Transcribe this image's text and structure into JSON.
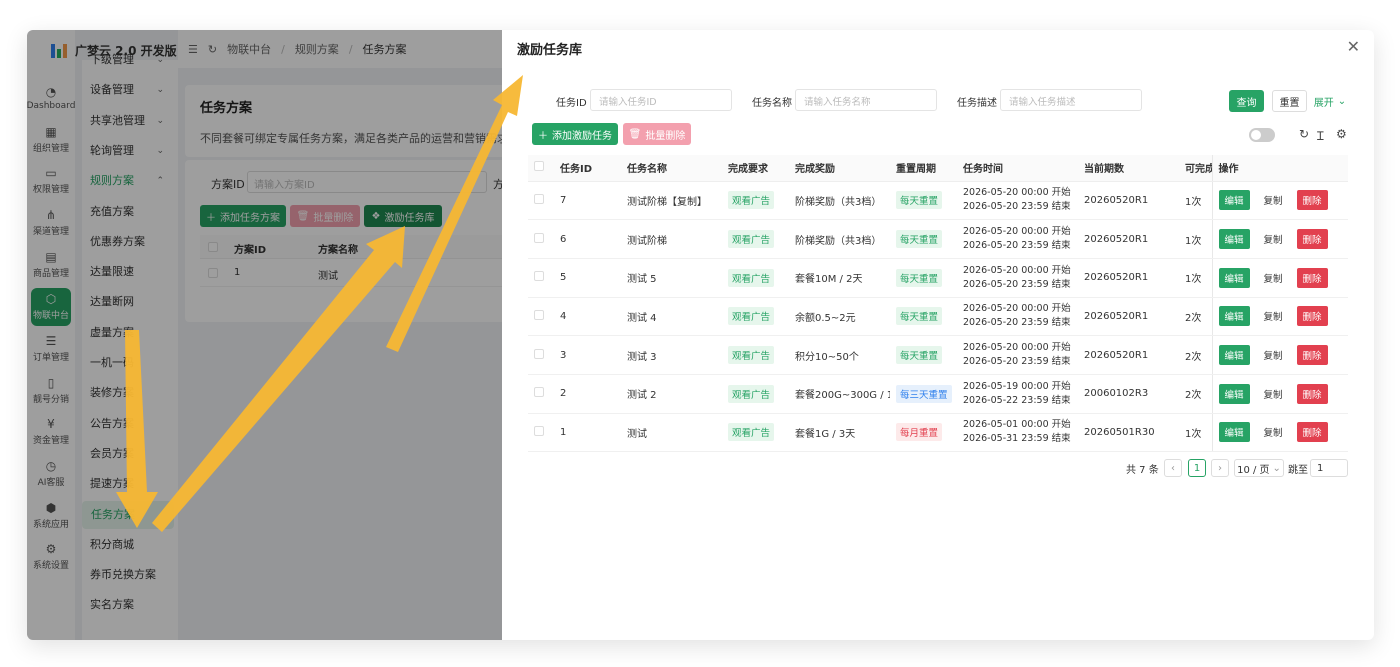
{
  "app": {
    "logo_text": "广梦云 2.0 开发版"
  },
  "rail": [
    {
      "icon": "dashboard-icon",
      "glyph": "◔",
      "label": "Dashboard"
    },
    {
      "icon": "org-icon",
      "glyph": "▦",
      "label": "组织管理"
    },
    {
      "icon": "monitor-icon",
      "glyph": "▭",
      "label": "权限管理"
    },
    {
      "icon": "channel-icon",
      "glyph": "⋔",
      "label": "渠道管理"
    },
    {
      "icon": "store-icon",
      "glyph": "▤",
      "label": "商品管理"
    },
    {
      "icon": "iot-icon",
      "glyph": "⬡",
      "label": "物联中台"
    },
    {
      "icon": "order-icon",
      "glyph": "☰",
      "label": "订单管理"
    },
    {
      "icon": "phone-icon",
      "glyph": "▯",
      "label": "靓号分销"
    },
    {
      "icon": "fund-icon",
      "glyph": "¥",
      "label": "资金管理"
    },
    {
      "icon": "ai-icon",
      "glyph": "◷",
      "label": "AI客服"
    },
    {
      "icon": "apps-icon",
      "glyph": "⬢",
      "label": "系统应用"
    },
    {
      "icon": "settings-icon",
      "glyph": "⚙",
      "label": "系统设置"
    }
  ],
  "menu2": [
    {
      "label": "下级管理",
      "type": "group"
    },
    {
      "label": "设备管理",
      "type": "group"
    },
    {
      "label": "共享池管理",
      "type": "group"
    },
    {
      "label": "轮询管理",
      "type": "group"
    },
    {
      "label": "规则方案",
      "type": "open"
    },
    {
      "label": "充值方案",
      "type": "sub"
    },
    {
      "label": "优惠券方案",
      "type": "sub"
    },
    {
      "label": "达量限速",
      "type": "sub"
    },
    {
      "label": "达量断网",
      "type": "sub"
    },
    {
      "label": "虚量方案",
      "type": "sub"
    },
    {
      "label": "一机一码",
      "type": "sub"
    },
    {
      "label": "装修方案",
      "type": "sub"
    },
    {
      "label": "公告方案",
      "type": "sub"
    },
    {
      "label": "会员方案",
      "type": "sub"
    },
    {
      "label": "提速方案",
      "type": "sub"
    },
    {
      "label": "任务方案",
      "type": "active"
    },
    {
      "label": "积分商城",
      "type": "sub"
    },
    {
      "label": "券币兑换方案",
      "type": "sub"
    },
    {
      "label": "实名方案",
      "type": "sub"
    }
  ],
  "breadcrumb": [
    "物联中台",
    "规则方案",
    "任务方案"
  ],
  "page": {
    "title": "任务方案",
    "desc": "不同套餐可绑定专属任务方案，满足各类产品的运营和营销需求。任务方案",
    "filter_label": "方案ID",
    "filter_placeholder": "请输入方案ID",
    "filter_label2": "方",
    "add_btn": "添加任务方案",
    "batch_del_btn": "批量删除",
    "incentive_btn": "激励任务库",
    "table_headers": [
      "方案ID",
      "方案名称"
    ],
    "rows": [
      {
        "id": "1",
        "name": "测试"
      }
    ]
  },
  "drawer": {
    "title": "激励任务库",
    "filters": [
      {
        "label": "任务ID",
        "placeholder": "请输入任务ID"
      },
      {
        "label": "任务名称",
        "placeholder": "请输入任务名称"
      },
      {
        "label": "任务描述",
        "placeholder": "请输入任务描述"
      }
    ],
    "search_btn": "查询",
    "reset_btn": "重置",
    "expand_btn": "展开",
    "add_btn": "添加激励任务",
    "batch_del_btn": "批量删除",
    "headers": [
      "任务ID",
      "任务名称",
      "完成要求",
      "完成奖励",
      "重置周期",
      "任务时间",
      "当前期数",
      "可完成次数",
      "操作"
    ],
    "rows": [
      {
        "id": "7",
        "name": "测试阶梯【复制】",
        "req": "观看广告",
        "reward": "阶梯奖励（共3档）",
        "cycle": "每天重置",
        "cycle_color": "g",
        "t1": "2026-05-20 00:00 开始",
        "t2": "2026-05-20 23:59 结束",
        "period": "20260520R1",
        "times": "1次"
      },
      {
        "id": "6",
        "name": "测试阶梯",
        "req": "观看广告",
        "reward": "阶梯奖励（共3档）",
        "cycle": "每天重置",
        "cycle_color": "g",
        "t1": "2026-05-20 00:00 开始",
        "t2": "2026-05-20 23:59 结束",
        "period": "20260520R1",
        "times": "1次"
      },
      {
        "id": "5",
        "name": "测试 5",
        "req": "观看广告",
        "reward": "套餐10M / 2天",
        "cycle": "每天重置",
        "cycle_color": "g",
        "t1": "2026-05-20 00:00 开始",
        "t2": "2026-05-20 23:59 结束",
        "period": "20260520R1",
        "times": "1次"
      },
      {
        "id": "4",
        "name": "测试 4",
        "req": "观看广告",
        "reward": "余额0.5~2元",
        "cycle": "每天重置",
        "cycle_color": "g",
        "t1": "2026-05-20 00:00 开始",
        "t2": "2026-05-20 23:59 结束",
        "period": "20260520R1",
        "times": "2次"
      },
      {
        "id": "3",
        "name": "测试 3",
        "req": "观看广告",
        "reward": "积分10~50个",
        "cycle": "每天重置",
        "cycle_color": "g",
        "t1": "2026-05-20 00:00 开始",
        "t2": "2026-05-20 23:59 结束",
        "period": "20260520R1",
        "times": "2次"
      },
      {
        "id": "2",
        "name": "测试 2",
        "req": "观看广告",
        "reward": "套餐200G~300G / 1…",
        "cycle": "每三天重置",
        "cycle_color": "b",
        "t1": "2026-05-19 00:00 开始",
        "t2": "2026-05-22 23:59 结束",
        "period": "20060102R3",
        "times": "2次"
      },
      {
        "id": "1",
        "name": "测试",
        "req": "观看广告",
        "reward": "套餐1G / 3天",
        "cycle": "每月重置",
        "cycle_color": "r",
        "t1": "2026-05-01 00:00 开始",
        "t2": "2026-05-31 23:59 结束",
        "period": "20260501R30",
        "times": "1次"
      }
    ],
    "ops": {
      "edit": "编辑",
      "copy": "复制",
      "del": "删除"
    },
    "pager": {
      "total": "共 7 条",
      "page": "1",
      "size": "10 / 页",
      "jump_label": "跳至",
      "jump_value": "1"
    }
  },
  "colors": {
    "accent": "#27a365",
    "danger": "#e2404f",
    "arrow": "#f7b733"
  }
}
